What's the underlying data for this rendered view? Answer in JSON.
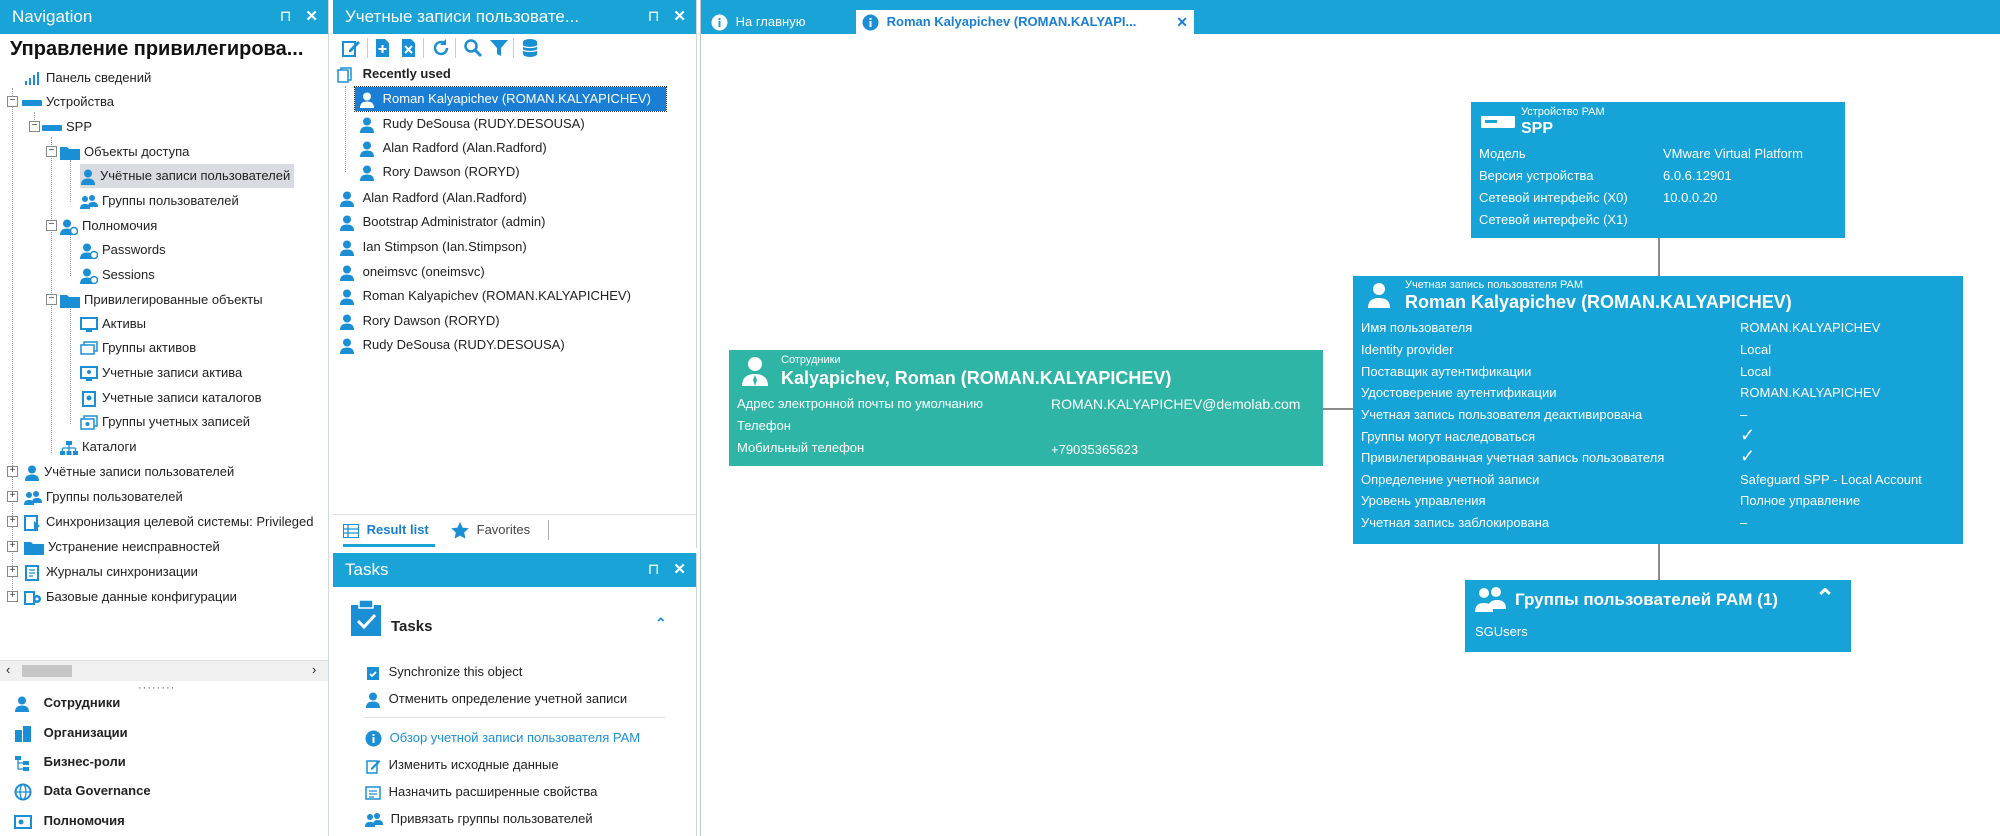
{
  "nav": {
    "title": "Navigation",
    "heading": "Управление привилегирова...",
    "tree": {
      "dashboard": "Панель сведений",
      "devices": "Устройства",
      "spp": "SPP",
      "access_objects": "Объекты доступа",
      "user_accounts": "Учётные записи пользователей",
      "user_groups_sub": "Группы пользователей",
      "permissions": "Полномочия",
      "passwords": "Passwords",
      "sessions": "Sessions",
      "priv_objects": "Привилегированные объекты",
      "assets": "Активы",
      "asset_groups": "Группы активов",
      "asset_accounts": "Учетные записи актива",
      "directory_accounts": "Учетные записи каталогов",
      "account_groups": "Группы учетных записей",
      "catalogs": "Каталоги",
      "top_user_accounts": "Учётные записи пользователей",
      "top_user_groups": "Группы пользователей",
      "sync": "Синхронизация целевой системы: Privileged",
      "troubleshooting": "Устранение неисправностей",
      "sync_logs": "Журналы синхронизации",
      "base_config": "Базовые данные конфигурации"
    },
    "bottom": [
      "Сотрудники",
      "Организации",
      "Бизнес-роли",
      "Data Governance",
      "Полномочия"
    ]
  },
  "list": {
    "title": "Учетные записи пользовате...",
    "group_label": "Recently used",
    "recent": [
      "Roman Kalyapichev (ROMAN.KALYAPICHEV)",
      "Rudy DeSousa (RUDY.DESOUSA)",
      "Alan Radford (Alan.Radford)",
      "Rory Dawson (RORYD)"
    ],
    "items": [
      "Alan Radford (Alan.Radford)",
      "Bootstrap Administrator (admin)",
      "Ian Stimpson (Ian.Stimpson)",
      "oneimsvc (oneimsvc)",
      "Roman Kalyapichev (ROMAN.KALYAPICHEV)",
      "Rory Dawson (RORYD)",
      "Rudy DeSousa (RUDY.DESOUSA)"
    ],
    "tab_results": "Result list",
    "tab_favorites": "Favorites"
  },
  "tasks": {
    "title": "Tasks",
    "header": "Tasks",
    "items": [
      "Synchronize this object",
      "Отменить определение учетной записи",
      "Обзор учетной записи пользователя PAM",
      "Изменить исходные данные",
      "Назначить расширенные свойства",
      "Привязать группы пользователей"
    ]
  },
  "tabs": {
    "home": "На главную",
    "active": "Roman Kalyapichev (ROMAN.KALYAPI..."
  },
  "device_card": {
    "caption": "Устройство PAM",
    "name": "SPP",
    "rows": [
      {
        "k": "Модель",
        "v": "VMware Virtual Platform"
      },
      {
        "k": "Версия устройства",
        "v": "6.0.6.12901"
      },
      {
        "k": "Сетевой интерфейс (X0)",
        "v": "10.0.0.20"
      },
      {
        "k": "Сетевой интерфейс (X1)",
        "v": ""
      }
    ]
  },
  "account_card": {
    "caption": "Учетная запись пользователя PAM",
    "name": "Roman Kalyapichev (ROMAN.KALYAPICHEV)",
    "rows": [
      {
        "k": "Имя пользователя",
        "v": "ROMAN.KALYAPICHEV"
      },
      {
        "k": "Identity provider",
        "v": "Local"
      },
      {
        "k": "Поставщик аутентификации",
        "v": "Local"
      },
      {
        "k": "Удостоверение аутентификации",
        "v": "ROMAN.KALYAPICHEV"
      },
      {
        "k": "Учетная запись пользователя деактивирована",
        "v": "–"
      },
      {
        "k": "Группы могут наследоваться",
        "v": "✓"
      },
      {
        "k": "Привилегированная учетная запись пользователя",
        "v": "✓"
      },
      {
        "k": "Определение учетной записи",
        "v": "Safeguard SPP - Local Account"
      },
      {
        "k": "Уровень управления",
        "v": "Полное управление"
      },
      {
        "k": "Учетная запись заблокирована",
        "v": "–"
      }
    ]
  },
  "employee_card": {
    "caption": "Сотрудники",
    "name": "Kalyapichev, Roman (ROMAN.KALYAPICHEV)",
    "rows": [
      {
        "k": "Адрес электронной почты по умолчанию",
        "v": "ROMAN.KALYAPICHEV@demolab.com"
      },
      {
        "k": "Телефон",
        "v": ""
      },
      {
        "k": "Мобильный телефон",
        "v": "+79035365623"
      }
    ]
  },
  "groups_card": {
    "title": "Группы пользователей PAM (1)",
    "item": "SGUsers"
  },
  "colors": {
    "accent": "#1aa3d6",
    "card_blue": "#15a3d8",
    "card_teal": "#2eb5a6",
    "selected": "#1a7fd4"
  }
}
